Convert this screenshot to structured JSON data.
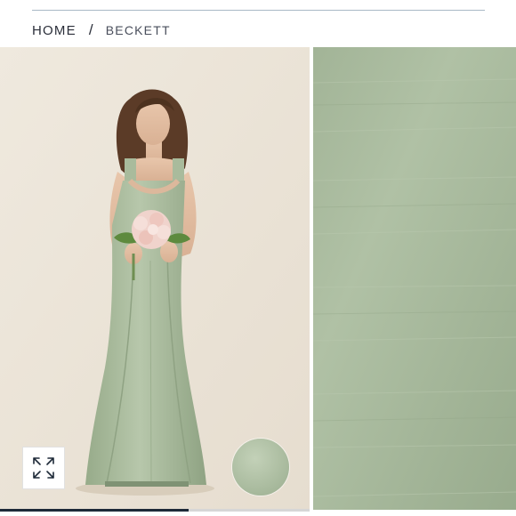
{
  "breadcrumb": {
    "home_label": "HOME",
    "separator": "/",
    "current_label": "BECKETT"
  },
  "gallery": {
    "expand_icon": "expand-arrows-icon",
    "progress_fraction": 0.61
  },
  "colors": {
    "dress_sage": "#a8b99c",
    "background_cream": "#ede6da",
    "fabric_swatch": "#a6b89b",
    "progress_fill": "#1e2a38",
    "rule": "#a9b8c6"
  }
}
